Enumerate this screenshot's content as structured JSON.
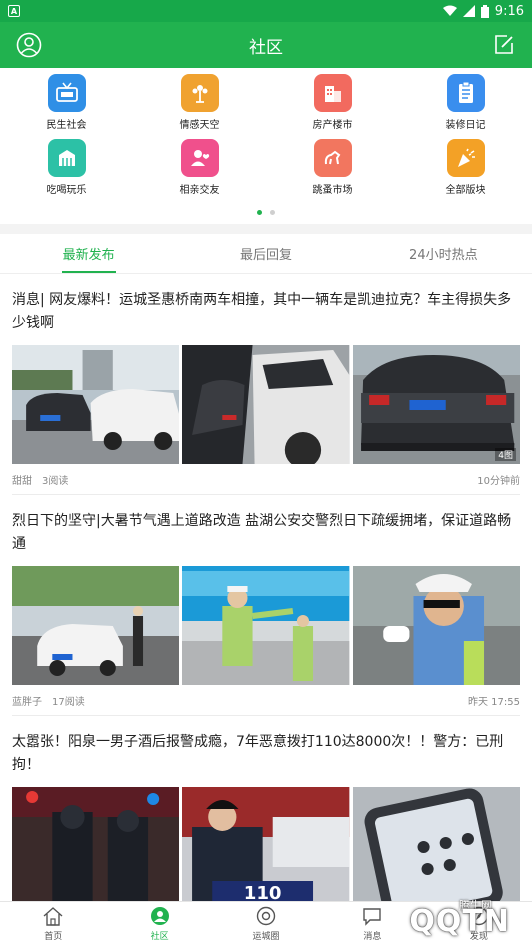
{
  "status_bar": {
    "time": "9:16"
  },
  "header": {
    "title": "社区"
  },
  "categories": [
    {
      "label": "民生社会",
      "icon": "tv-icon",
      "color": "#2f8fe6"
    },
    {
      "label": "情感天空",
      "icon": "flower-icon",
      "color": "#f0a230"
    },
    {
      "label": "房产楼市",
      "icon": "building-icon",
      "color": "#f26a5f"
    },
    {
      "label": "装修日记",
      "icon": "notebook-icon",
      "color": "#3a8eee"
    },
    {
      "label": "吃喝玩乐",
      "icon": "shopping-bag-icon",
      "color": "#2cc1a6"
    },
    {
      "label": "相亲交友",
      "icon": "heart-user-icon",
      "color": "#f0508c"
    },
    {
      "label": "跳蚤市场",
      "icon": "flea-icon",
      "color": "#f2765f"
    },
    {
      "label": "全部版块",
      "icon": "party-popper-icon",
      "color": "#f3a126"
    }
  ],
  "tabs": [
    {
      "label": "最新发布",
      "active": true
    },
    {
      "label": "最后回复",
      "active": false
    },
    {
      "label": "24小时热点",
      "active": false
    }
  ],
  "posts": [
    {
      "title": "消息| 网友爆料！运城圣惠桥南两车相撞，其中一辆车是凯迪拉克？车主得损失多少钱啊",
      "author": "甜甜",
      "reads": "3阅读",
      "time": "10分钟前",
      "image_count": "4图"
    },
    {
      "title": "烈日下的坚守|大暑节气遇上道路改造 盐湖公安交警烈日下疏缓拥堵，保证道路畅通",
      "author": "蓝胖子",
      "reads": "17阅读",
      "time": "昨天 17:55"
    },
    {
      "title": "太嚣张！阳泉一男子酒后报警成瘾，7年恶意拨打110达8000次！！警方：已刑拘！",
      "image_text": "110"
    }
  ],
  "bottom_nav": [
    {
      "label": "首页",
      "icon": "home-icon",
      "active": false
    },
    {
      "label": "社区",
      "icon": "community-icon",
      "active": true
    },
    {
      "label": "运城圈",
      "icon": "camera-circle-icon",
      "active": false
    },
    {
      "label": "消息",
      "icon": "message-icon",
      "active": false
    },
    {
      "label": "发现",
      "icon": "discover-icon",
      "active": false
    }
  ],
  "watermark": {
    "text": "QQTN",
    "small": "腾牛网"
  }
}
